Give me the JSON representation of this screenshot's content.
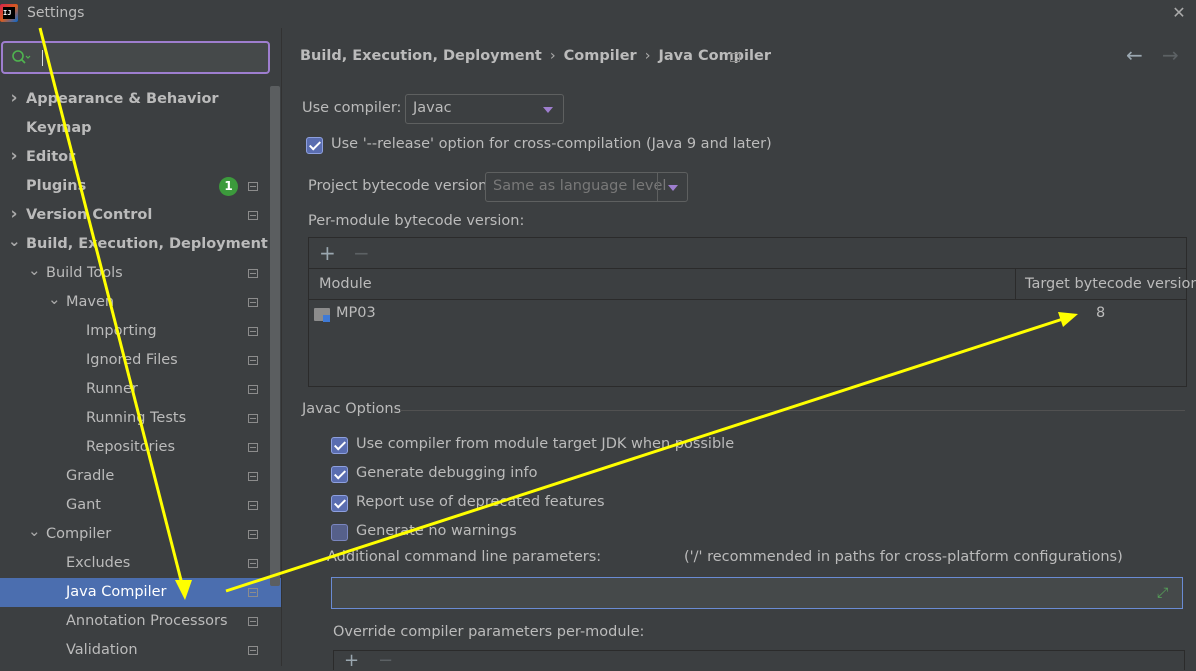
{
  "window": {
    "title": "Settings",
    "app_icon_text": "IJ",
    "close_glyph": "✕"
  },
  "search": {
    "value": "",
    "placeholder": ""
  },
  "sidebar": {
    "items": [
      {
        "label": "Appearance & Behavior",
        "level": 0,
        "expander": "collapsed",
        "bold": true
      },
      {
        "label": "Keymap",
        "level": 0,
        "expander": "none",
        "bold": true
      },
      {
        "label": "Editor",
        "level": 0,
        "expander": "collapsed",
        "bold": true
      },
      {
        "label": "Plugins",
        "level": 0,
        "expander": "none",
        "bold": true,
        "badge": "1",
        "project_icon": true
      },
      {
        "label": "Version Control",
        "level": 0,
        "expander": "collapsed",
        "bold": true,
        "project_icon": true
      },
      {
        "label": "Build, Execution, Deployment",
        "level": 0,
        "expander": "expanded",
        "bold": true
      },
      {
        "label": "Build Tools",
        "level": 1,
        "expander": "expanded",
        "project_icon": true
      },
      {
        "label": "Maven",
        "level": 2,
        "expander": "expanded",
        "project_icon": true
      },
      {
        "label": "Importing",
        "level": 3,
        "expander": "none",
        "project_icon": true
      },
      {
        "label": "Ignored Files",
        "level": 3,
        "expander": "none",
        "project_icon": true
      },
      {
        "label": "Runner",
        "level": 3,
        "expander": "none",
        "project_icon": true
      },
      {
        "label": "Running Tests",
        "level": 3,
        "expander": "none",
        "project_icon": true
      },
      {
        "label": "Repositories",
        "level": 3,
        "expander": "none",
        "project_icon": true
      },
      {
        "label": "Gradle",
        "level": 2,
        "expander": "none",
        "project_icon": true
      },
      {
        "label": "Gant",
        "level": 2,
        "expander": "none",
        "project_icon": true
      },
      {
        "label": "Compiler",
        "level": 1,
        "expander": "expanded",
        "project_icon": true
      },
      {
        "label": "Excludes",
        "level": 2,
        "expander": "none",
        "project_icon": true
      },
      {
        "label": "Java Compiler",
        "level": 2,
        "expander": "none",
        "project_icon": true,
        "selected": true
      },
      {
        "label": "Annotation Processors",
        "level": 2,
        "expander": "none",
        "project_icon": true
      },
      {
        "label": "Validation",
        "level": 2,
        "expander": "none",
        "project_icon": true
      }
    ]
  },
  "breadcrumb": {
    "parts": [
      "Build, Execution, Deployment",
      "Compiler",
      "Java Compiler"
    ],
    "separator": "›"
  },
  "nav": {
    "back_glyph": "←",
    "forward_glyph": "→"
  },
  "compiler": {
    "use_compiler_label": "Use compiler:",
    "use_compiler_value": "Javac",
    "release_option_label": "Use '--release' option for cross-compilation (Java 9 and later)",
    "release_option_checked": true,
    "project_bytecode_label": "Project bytecode version:",
    "project_bytecode_value": "Same as language level",
    "per_module_label": "Per-module bytecode version:",
    "table": {
      "add_glyph": "+",
      "remove_glyph": "−",
      "columns": [
        "Module",
        "Target bytecode version"
      ],
      "rows": [
        {
          "module": "MP03",
          "target": "8"
        }
      ]
    }
  },
  "javac_options": {
    "section_title": "Javac Options",
    "checkboxes": [
      {
        "label": "Use compiler from module target JDK when possible",
        "checked": true
      },
      {
        "label": "Generate debugging info",
        "checked": true
      },
      {
        "label": "Report use of deprecated features",
        "checked": true
      },
      {
        "label": "Generate no warnings",
        "checked": false
      }
    ],
    "additional_params_label": "Additional command line parameters:",
    "additional_params_hint": "('/' recommended in paths for cross-platform configurations)",
    "additional_params_value": "",
    "expand_glyph": "⤢",
    "override_label": "Override compiler parameters per-module:",
    "override_add_glyph": "+",
    "override_remove_glyph": "−"
  },
  "colors": {
    "background": "#3c3f41",
    "selection": "#4b6eaf",
    "focus_border": "#9e7ecf",
    "annotation_arrow": "#ffff00",
    "badge": "#3c9a3c"
  }
}
